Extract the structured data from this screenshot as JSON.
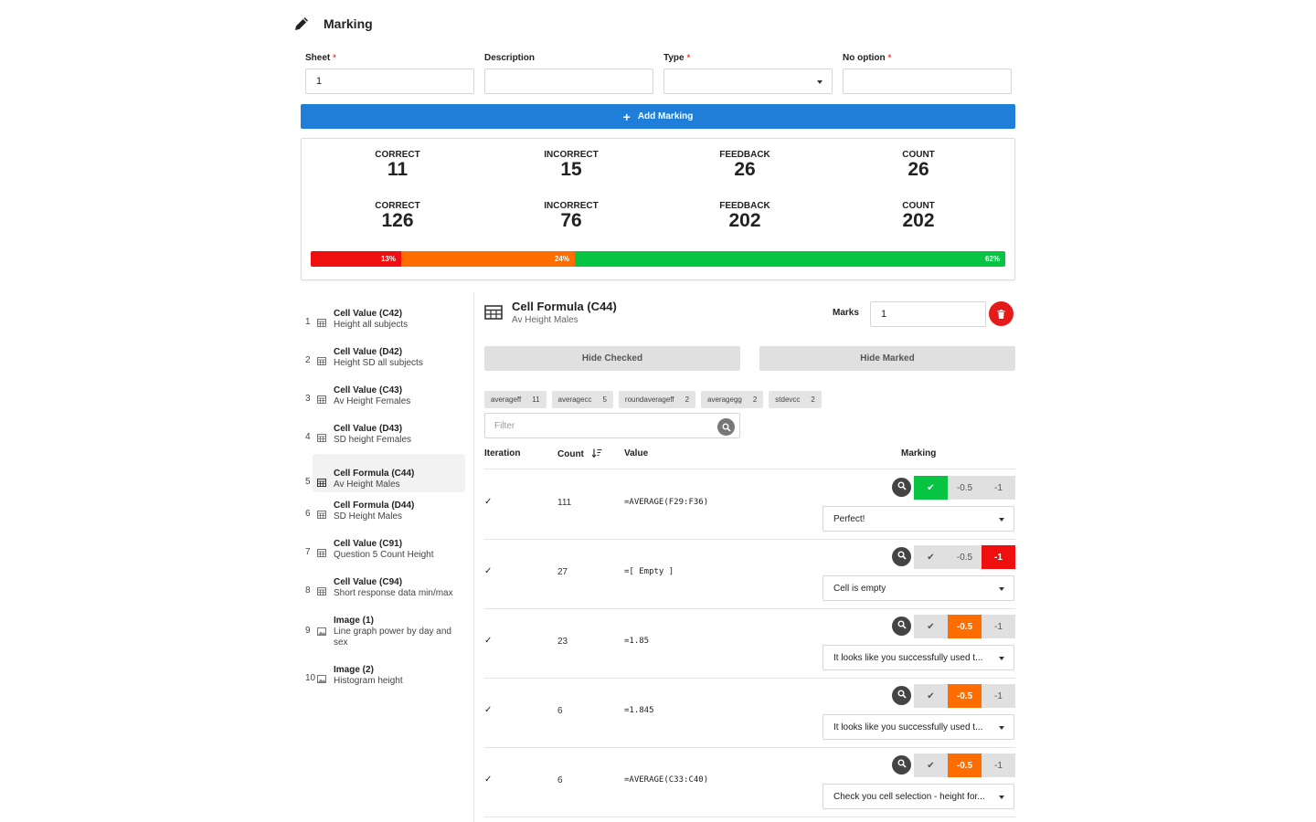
{
  "header": {
    "title": "Marking",
    "icon": "pencil-icon"
  },
  "form": {
    "sheet": {
      "label": "Sheet",
      "value": "1"
    },
    "description": {
      "label": "Description",
      "value": ""
    },
    "type": {
      "label": "Type",
      "value": ""
    },
    "no_option": {
      "label": "No option",
      "value": ""
    },
    "required_marker": "*"
  },
  "add_button": {
    "label": "Add Marking",
    "icon": "plus-icon"
  },
  "stats": {
    "row1": [
      {
        "label": "CORRECT",
        "value": "11"
      },
      {
        "label": "INCORRECT",
        "value": "15"
      },
      {
        "label": "FEEDBACK",
        "value": "26"
      },
      {
        "label": "COUNT",
        "value": "26"
      }
    ],
    "row2": [
      {
        "label": "CORRECT",
        "value": "126"
      },
      {
        "label": "INCORRECT",
        "value": "76"
      },
      {
        "label": "FEEDBACK",
        "value": "202"
      },
      {
        "label": "COUNT",
        "value": "202"
      }
    ],
    "progress": [
      {
        "label": "13%",
        "fraction": 0.13,
        "color": "#ef0f0f"
      },
      {
        "label": "24%",
        "fraction": 0.25,
        "color": "#ff6d00"
      },
      {
        "label": "62%",
        "fraction": 0.62,
        "color": "#07c443"
      }
    ]
  },
  "sidebar": {
    "items": [
      {
        "num": "1",
        "title": "Cell Value (C42)",
        "sub": "Height all subjects",
        "icon": "table-icon"
      },
      {
        "num": "2",
        "title": "Cell Value (D42)",
        "sub": "Height SD all subjects",
        "icon": "table-icon"
      },
      {
        "num": "3",
        "title": "Cell Value (C43)",
        "sub": "Av Height Females",
        "icon": "table-icon"
      },
      {
        "num": "4",
        "title": "Cell Value (D43)",
        "sub": "SD height Females",
        "icon": "table-icon"
      },
      {
        "num": "5",
        "title": "Cell Formula (C44)",
        "sub": "Av Height Males",
        "icon": "table-icon"
      },
      {
        "num": "6",
        "title": "Cell Formula (D44)",
        "sub": "SD Height Males",
        "icon": "table-icon"
      },
      {
        "num": "7",
        "title": "Cell Value (C91)",
        "sub": "Question 5 Count Height",
        "icon": "table-icon"
      },
      {
        "num": "8",
        "title": "Cell Value (C94)",
        "sub": "Short response data min/max",
        "icon": "table-icon"
      },
      {
        "num": "9",
        "title": "Image (1)",
        "sub": "Line graph power by day and sex",
        "icon": "image-icon"
      },
      {
        "num": "10",
        "title": "Image (2)",
        "sub": "Histogram height",
        "icon": "image-icon"
      }
    ]
  },
  "detail": {
    "title": "Cell Formula (C44)",
    "subtitle": "Av Height Males",
    "marks_label": "Marks",
    "marks_value": "1",
    "hide_checked": "Hide Checked",
    "hide_marked": "Hide Marked",
    "filter_placeholder": "Filter",
    "tags": [
      {
        "name": "averageff",
        "count": "11"
      },
      {
        "name": "averagecc",
        "count": "5"
      },
      {
        "name": "roundaverageff",
        "count": "2"
      },
      {
        "name": "averagegg",
        "count": "2"
      },
      {
        "name": "stdevcc",
        "count": "2"
      }
    ],
    "columns": {
      "iteration": "Iteration",
      "count": "Count",
      "value": "Value",
      "marking": "Marking"
    },
    "rows": [
      {
        "check": "✓",
        "count": "111",
        "value": "=AVERAGE(F29:F36)",
        "selected": "check",
        "feedback": "Perfect!"
      },
      {
        "check": "✓",
        "count": "27",
        "value": "=[ Empty ]",
        "selected": "-1",
        "feedback": "Cell is empty"
      },
      {
        "check": "✓",
        "count": "23",
        "value": "=1.85",
        "selected": "-0.5",
        "feedback": "It looks like you successfully used t..."
      },
      {
        "check": "✓",
        "count": "6",
        "value": "=1.845",
        "selected": "-0.5",
        "feedback": "It looks like you successfully used t..."
      },
      {
        "check": "✓",
        "count": "6",
        "value": "=AVERAGE(C33:C40)",
        "selected": "-0.5",
        "feedback": "Check you cell selection - height for..."
      }
    ],
    "mark_options": [
      "✔",
      "-0.5",
      "-1"
    ]
  }
}
